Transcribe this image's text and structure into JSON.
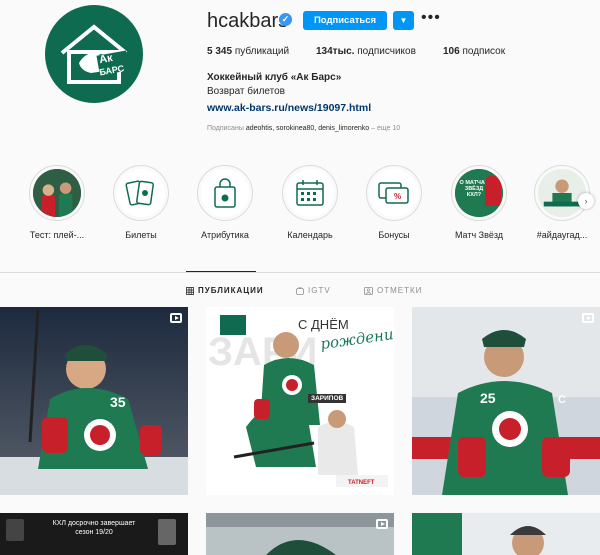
{
  "profile": {
    "username": "hcakbars",
    "follow_label": "Подписаться",
    "full_name": "Хоккейный клуб «Ак Барс»",
    "bio": "Возврат билетов",
    "website": "www.ak-bars.ru/news/19097.html",
    "followed_by_prefix": "Подписаны",
    "followed_by_users": "adeohtis, sorokinea80, denis_limorenko",
    "followed_by_suffix": "– еще 10",
    "brand_color": "#0e6b4f",
    "accent_color": "#0095f6"
  },
  "stats": {
    "posts": "5 345",
    "posts_label": "публикаций",
    "followers": "134тыс.",
    "followers_label": "подписчиков",
    "following": "106",
    "following_label": "подписок"
  },
  "highlights": [
    {
      "label": "Тест: плей-...",
      "icon": "photo-thumbnail"
    },
    {
      "label": "Билеты",
      "icon": "ticket-icon"
    },
    {
      "label": "Атрибутика",
      "icon": "shopping-bag-icon"
    },
    {
      "label": "Календарь",
      "icon": "calendar-icon"
    },
    {
      "label": "Бонусы",
      "icon": "bonus-card-icon"
    },
    {
      "label": "Матч Звёзд",
      "icon": "photo-thumbnail"
    },
    {
      "label": "#айдаугад...",
      "icon": "photo-thumbnail"
    }
  ],
  "tabs": [
    {
      "label": "ПУБЛИКАЦИИ",
      "icon": "grid-icon",
      "active": true
    },
    {
      "label": "IGTV",
      "icon": "igtv-icon",
      "active": false
    },
    {
      "label": "ОТМЕТКИ",
      "icon": "tag-icon",
      "active": false
    }
  ],
  "posts": {
    "bday_title": "С ДНЁМ",
    "bday_script": "рождения!",
    "bday_name": "ЗАРИПОВ",
    "jersey_1": "35",
    "jersey_2": "25",
    "khl_text": "КХЛ досрочно завершает сезон 19/20",
    "highlight_match_text": "О МАТЧАХ ЗВЁЗД КХЛ?"
  }
}
